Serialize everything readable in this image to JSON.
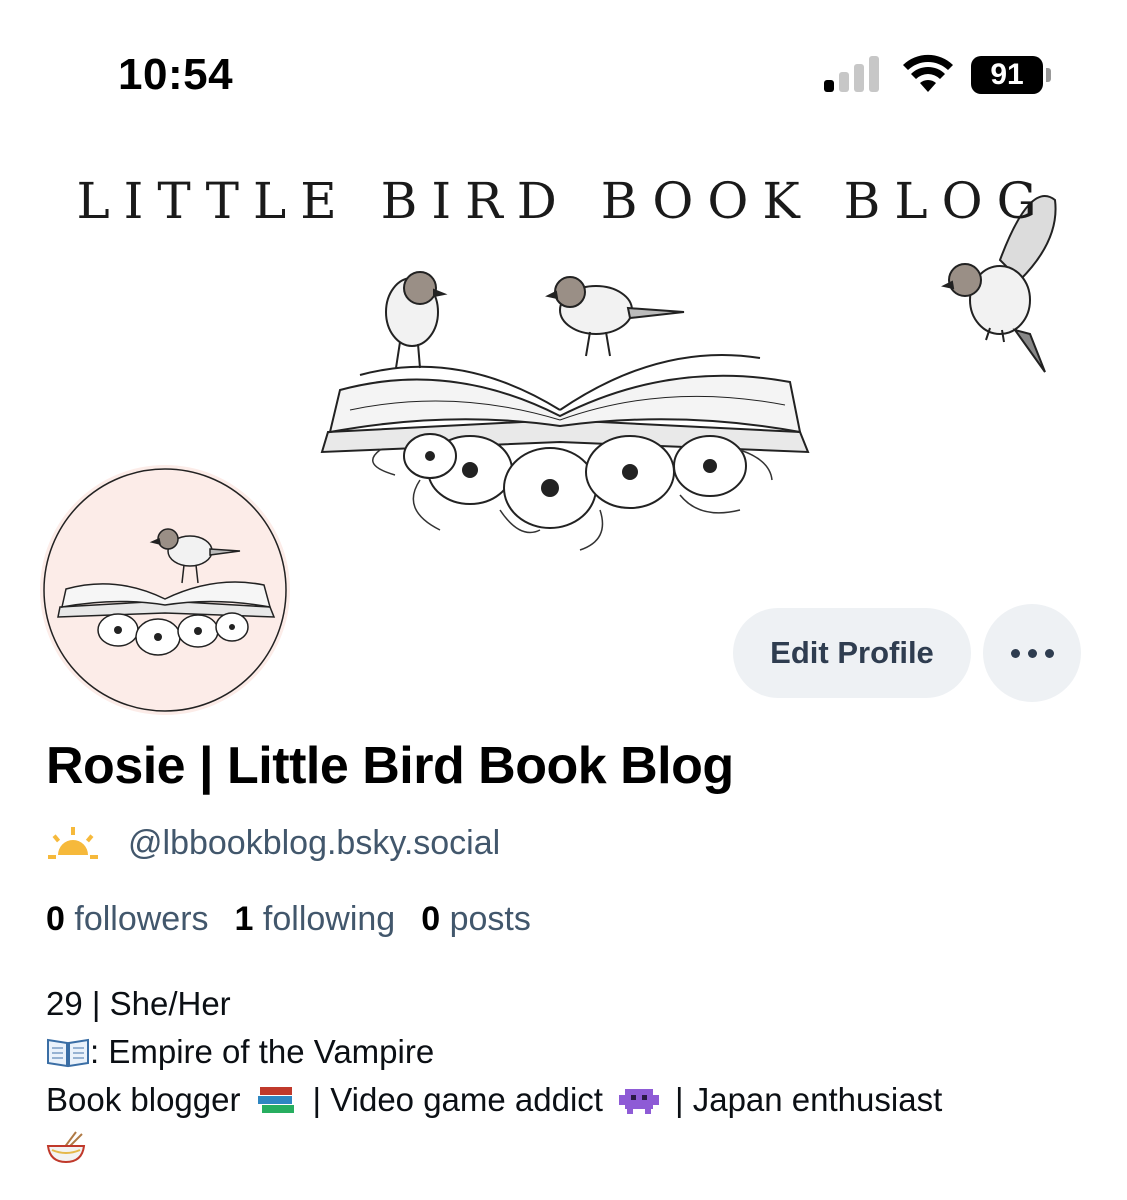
{
  "status_bar": {
    "time": "10:54",
    "battery": "91",
    "signal_icon": "cellular-signal-icon",
    "wifi_icon": "wifi-icon"
  },
  "banner": {
    "title": "LITTLE BIRD BOOK BLOG",
    "image": "birds-on-open-book-with-flowers illustration"
  },
  "avatar": {
    "image": "bird-on-open-book-with-flowers illustration",
    "background": "#fcece8"
  },
  "actions": {
    "edit_profile": "Edit Profile",
    "more_icon": "ellipsis-icon"
  },
  "profile": {
    "display_name": "Rosie | Little Bird Book Blog",
    "handle_emoji": "sunrise-emoji",
    "handle": "@lbbookblog.bsky.social",
    "stats": [
      {
        "count": "0",
        "label": "followers"
      },
      {
        "count": "1",
        "label": "following"
      },
      {
        "count": "0",
        "label": "posts"
      }
    ],
    "bio": {
      "line1": "29 | She/Her",
      "line2_icon": "open-book-emoji",
      "line2": ": Empire of the Vampire",
      "line3_a": "Book blogger",
      "line3_icon_a": "books-emoji",
      "line3_b": "| Video game addict",
      "line3_icon_b": "alien-monster-emoji",
      "line3_c": "| Japan enthusiast",
      "line4_icon": "ramen-bowl-emoji"
    }
  },
  "colors": {
    "muted_text": "#42576c",
    "button_bg": "#eef1f4",
    "button_text": "#2f3d50"
  }
}
